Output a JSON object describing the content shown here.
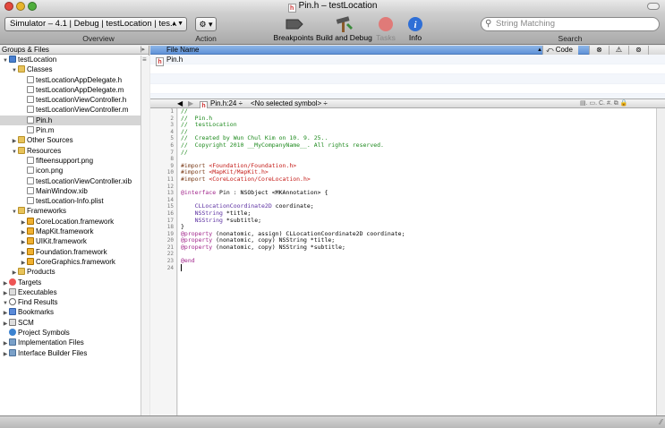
{
  "window": {
    "title": "Pin.h – testLocation"
  },
  "toolbar": {
    "scheme": "Simulator – 4.1 | Debug | testLocation | tes...",
    "overview_label": "Overview",
    "action_label": "Action",
    "breakpoints_label": "Breakpoints",
    "build_label": "Build and Debug",
    "tasks_label": "Tasks",
    "info_label": "Info",
    "search_placeholder": "String Matching",
    "search_label": "Search"
  },
  "sidebar": {
    "header": "Groups & Files",
    "items": [
      {
        "label": "testLocation",
        "indent": 0,
        "tri": "▼",
        "icon": "f-proj"
      },
      {
        "label": "Classes",
        "indent": 1,
        "tri": "▼",
        "icon": "f-folder"
      },
      {
        "label": "testLocationAppDelegate.h",
        "indent": 2,
        "tri": "",
        "icon": "f-file"
      },
      {
        "label": "testLocationAppDelegate.m",
        "indent": 2,
        "tri": "",
        "icon": "f-file"
      },
      {
        "label": "testLocationViewController.h",
        "indent": 2,
        "tri": "",
        "icon": "f-file"
      },
      {
        "label": "testLocationViewController.m",
        "indent": 2,
        "tri": "",
        "icon": "f-file"
      },
      {
        "label": "Pin.h",
        "indent": 2,
        "tri": "",
        "icon": "f-file",
        "selected": true
      },
      {
        "label": "Pin.m",
        "indent": 2,
        "tri": "",
        "icon": "f-file"
      },
      {
        "label": "Other Sources",
        "indent": 1,
        "tri": "▶",
        "icon": "f-folder"
      },
      {
        "label": "Resources",
        "indent": 1,
        "tri": "▼",
        "icon": "f-folder"
      },
      {
        "label": "fifteensupport.png",
        "indent": 2,
        "tri": "",
        "icon": "f-file"
      },
      {
        "label": "icon.png",
        "indent": 2,
        "tri": "",
        "icon": "f-file"
      },
      {
        "label": "testLocationViewController.xib",
        "indent": 2,
        "tri": "",
        "icon": "f-file"
      },
      {
        "label": "MainWindow.xib",
        "indent": 2,
        "tri": "",
        "icon": "f-file"
      },
      {
        "label": "testLocation-Info.plist",
        "indent": 2,
        "tri": "",
        "icon": "f-file"
      },
      {
        "label": "Frameworks",
        "indent": 1,
        "tri": "▼",
        "icon": "f-folder"
      },
      {
        "label": "CoreLocation.framework",
        "indent": 2,
        "tri": "▶",
        "icon": "f-fw"
      },
      {
        "label": "MapKit.framework",
        "indent": 2,
        "tri": "▶",
        "icon": "f-fw"
      },
      {
        "label": "UIKit.framework",
        "indent": 2,
        "tri": "▶",
        "icon": "f-fw"
      },
      {
        "label": "Foundation.framework",
        "indent": 2,
        "tri": "▶",
        "icon": "f-fw"
      },
      {
        "label": "CoreGraphics.framework",
        "indent": 2,
        "tri": "▶",
        "icon": "f-fw"
      },
      {
        "label": "Products",
        "indent": 1,
        "tri": "▶",
        "icon": "f-folder"
      },
      {
        "label": "Targets",
        "indent": 0,
        "tri": "▶",
        "icon": "f-target"
      },
      {
        "label": "Executables",
        "indent": 0,
        "tri": "▶",
        "icon": "f-exe"
      },
      {
        "label": "Find Results",
        "indent": 0,
        "tri": "▼",
        "icon": "f-find"
      },
      {
        "label": "Bookmarks",
        "indent": 0,
        "tri": "▶",
        "icon": "f-book"
      },
      {
        "label": "SCM",
        "indent": 0,
        "tri": "▶",
        "icon": "f-scm"
      },
      {
        "label": "Project Symbols",
        "indent": 0,
        "tri": "",
        "icon": "f-sym"
      },
      {
        "label": "Implementation Files",
        "indent": 0,
        "tri": "▶",
        "icon": "f-smart"
      },
      {
        "label": "Interface Builder Files",
        "indent": 0,
        "tri": "▶",
        "icon": "f-smart"
      }
    ]
  },
  "filelist": {
    "header_name": "File Name",
    "header_code": "Code",
    "rows": [
      "Pin.h",
      "",
      "",
      "",
      ""
    ]
  },
  "editor": {
    "file_popup": "Pin.h:24 ÷",
    "symbol_popup": "<No selected symbol> ÷",
    "lines": [
      [
        [
          "//",
          "c"
        ]
      ],
      [
        [
          "//  Pin.h",
          "c"
        ]
      ],
      [
        [
          "//  testLocation",
          "c"
        ]
      ],
      [
        [
          "//",
          "c"
        ]
      ],
      [
        [
          "//  Created by Wun Chul Kim on 10. 9. 25..",
          "c"
        ]
      ],
      [
        [
          "//  Copyright 2010 __MyCompanyName__. All rights reserved.",
          "c"
        ]
      ],
      [
        [
          "//",
          "c"
        ]
      ],
      [
        [
          "",
          ""
        ]
      ],
      [
        [
          "#import ",
          "p"
        ],
        [
          "<Foundation/Foundation.h>",
          "s"
        ]
      ],
      [
        [
          "#import ",
          "p"
        ],
        [
          "<MapKit/MapKit.h>",
          "s"
        ]
      ],
      [
        [
          "#import ",
          "p"
        ],
        [
          "<CoreLocation/CoreLocation.h>",
          "s"
        ]
      ],
      [
        [
          "",
          ""
        ]
      ],
      [
        [
          "@interface",
          "k"
        ],
        [
          " Pin : NSObject <MKAnnotation> {",
          ""
        ]
      ],
      [
        [
          "",
          ""
        ]
      ],
      [
        [
          "    CLLocationCoordinate2D",
          "t"
        ],
        [
          " coordinate;",
          ""
        ]
      ],
      [
        [
          "    NSString",
          "t"
        ],
        [
          " *title;",
          ""
        ]
      ],
      [
        [
          "    NSString",
          "t"
        ],
        [
          " *subtitle;",
          ""
        ]
      ],
      [
        [
          "}",
          ""
        ]
      ],
      [
        [
          "@property",
          "k"
        ],
        [
          " (nonatomic, assign) CLLocationCoordinate2D coordinate;",
          ""
        ]
      ],
      [
        [
          "@property",
          "k"
        ],
        [
          " (nonatomic, copy) NSString *title;",
          ""
        ]
      ],
      [
        [
          "@property",
          "k"
        ],
        [
          " (nonatomic, copy) NSString *subtitle;",
          ""
        ]
      ],
      [
        [
          "",
          ""
        ]
      ],
      [
        [
          "@end",
          "k"
        ]
      ],
      [
        [
          "",
          ""
        ]
      ]
    ]
  },
  "colors": {
    "comment": "#1e8a1e",
    "preproc": "#7a3b18",
    "string": "#c41a16",
    "keyword": "#a0248a",
    "type": "#5a2da0"
  }
}
